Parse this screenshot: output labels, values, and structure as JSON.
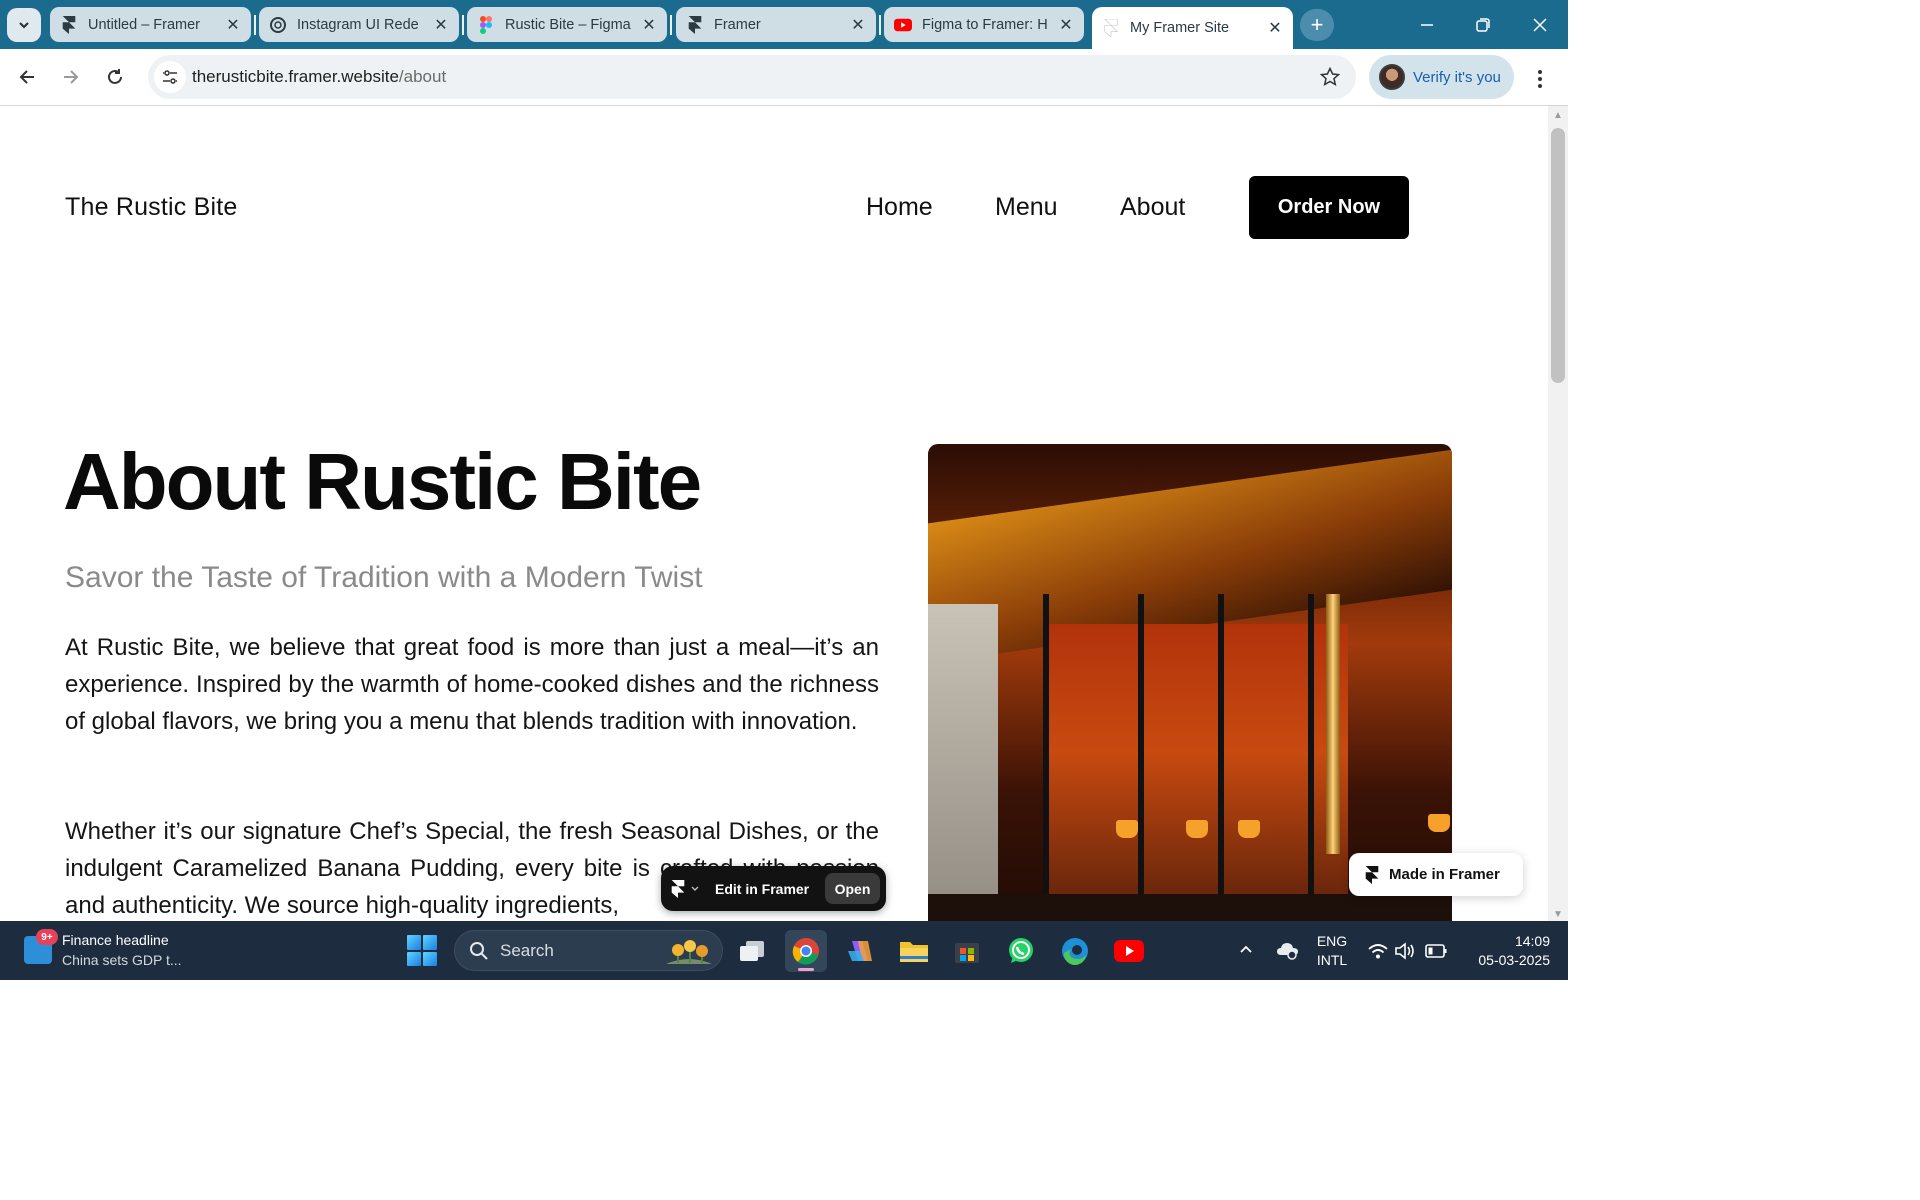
{
  "browser": {
    "tabs": [
      {
        "title": "Untitled – Framer",
        "favicon": "framer-icon"
      },
      {
        "title": "Instagram UI Rede",
        "favicon": "chatgpt-icon"
      },
      {
        "title": "Rustic Bite – Figma",
        "favicon": "figma-icon"
      },
      {
        "title": "Framer",
        "favicon": "framer-icon"
      },
      {
        "title": "Figma to Framer: H",
        "favicon": "youtube-icon"
      },
      {
        "title": "My Framer Site",
        "favicon": "framer-icon",
        "active": true
      }
    ],
    "url_host": "therusticbite.framer.website",
    "url_path": "/about",
    "profile_label": "Verify it's you"
  },
  "site": {
    "logo": "The Rustic Bite",
    "nav": [
      "Home",
      "Menu",
      "About"
    ],
    "cta": "Order Now",
    "title": "About Rustic Bite",
    "subtitle": "Savor the Taste of Tradition with a Modern Twist",
    "paragraph1": "At Rustic Bite, we believe that great food is more than just a meal—it’s an experience. Inspired by the warmth of home-cooked dishes and the richness of global flavors, we bring you a menu that blends tradition with innovation.",
    "paragraph2": "Whether it’s our signature Chef’s Special, the fresh Seasonal Dishes, or the indulgent Caramelized Banana Pudding, every bite is crafted with passion and authenticity. We source high-quality ingredients,"
  },
  "framer": {
    "edit_label": "Edit in Framer",
    "open_label": "Open",
    "made_in": "Made in Framer"
  },
  "taskbar": {
    "news_badge": "9+",
    "news_title": "Finance headline",
    "news_sub": "China sets GDP t...",
    "search_placeholder": "Search",
    "lang_top": "ENG",
    "lang_bottom": "INTL",
    "time": "14:09",
    "date": "05-03-2025"
  },
  "colors": {
    "tabstrip": "#1b6b8f",
    "cta_bg": "#000000",
    "taskbar": "#1d2d3f",
    "profile_text": "#1a5fa8"
  }
}
